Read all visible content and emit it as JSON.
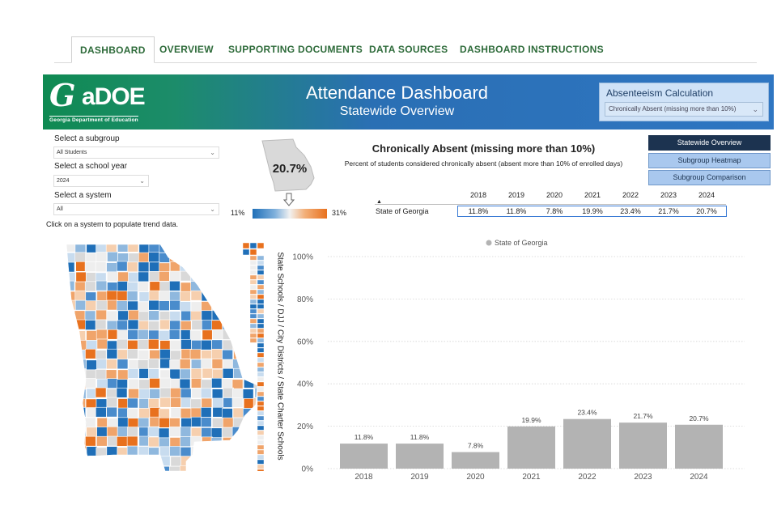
{
  "tabs": [
    {
      "label": "DASHBOARD",
      "active": true
    },
    {
      "label": "OVERVIEW",
      "active": false
    },
    {
      "label": "SUPPORTING DOCUMENTS",
      "active": false
    },
    {
      "label": "DATA SOURCES",
      "active": false
    },
    {
      "label": "DASHBOARD INSTRUCTIONS",
      "active": false
    }
  ],
  "banner": {
    "logo_mark": "G",
    "logo_text": "aDOE",
    "logo_sub": "Georgia Department of Education",
    "title": "Attendance Dashboard",
    "subtitle": "Statewide Overview",
    "calc_label": "Absenteeism Calculation",
    "calc_value": "Chronically Absent (missing more than 10%)"
  },
  "filters": {
    "subgroup_label": "Select a subgroup",
    "subgroup_value": "All Students",
    "year_label": "Select a school year",
    "year_value": "2024",
    "system_label": "Select a system",
    "system_value": "All",
    "hint": "Click on a system to populate trend data."
  },
  "state_summary": {
    "value": "20.7%",
    "scale_min": "11%",
    "scale_max": "31%"
  },
  "heading": {
    "title": "Chronically Absent (missing more than 10%)",
    "subtitle": "Percent of students considered chronically absent (absent more than 10% of enrolled days)"
  },
  "nav_buttons": [
    {
      "label": "Statewide Overview",
      "active": true
    },
    {
      "label": "Subgroup Heatmap",
      "active": false
    },
    {
      "label": "Subgroup Comparison",
      "active": false
    }
  ],
  "table": {
    "sort_icon": "sort-asc-icon",
    "years": [
      "2018",
      "2019",
      "2020",
      "2021",
      "2022",
      "2023",
      "2024"
    ],
    "row_label": "State of Georgia",
    "values": [
      "11.8%",
      "11.8%",
      "7.8%",
      "19.9%",
      "23.4%",
      "21.7%",
      "20.7%"
    ]
  },
  "map": {
    "side_label": "State Schools / DJJ / City Districts / State Charter Schools",
    "colors": {
      "low": "#1f6fb8",
      "mid": "#f1f1f1",
      "high": "#e8711e"
    }
  },
  "chart_data": {
    "type": "bar",
    "legend": [
      "State of Georgia"
    ],
    "legend_position": "top",
    "categories": [
      "2018",
      "2019",
      "2020",
      "2021",
      "2022",
      "2023",
      "2024"
    ],
    "series": [
      {
        "name": "State of Georgia",
        "values": [
          11.8,
          11.8,
          7.8,
          19.9,
          23.4,
          21.7,
          20.7
        ]
      }
    ],
    "data_labels": [
      "11.8%",
      "11.8%",
      "7.8%",
      "19.9%",
      "23.4%",
      "21.7%",
      "20.7%"
    ],
    "yticks": [
      "0%",
      "20%",
      "40%",
      "60%",
      "80%",
      "100%"
    ],
    "ylim": [
      0,
      100
    ],
    "grid": true,
    "bar_color": "#b3b3b3"
  }
}
